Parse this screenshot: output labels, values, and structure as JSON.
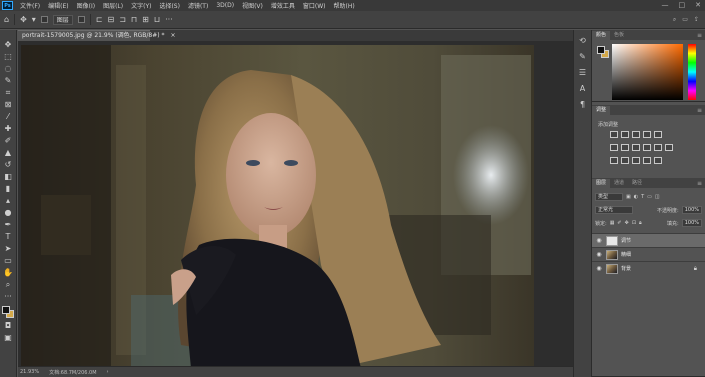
{
  "menubar": {
    "logo": "Ps",
    "items": [
      "文件(F)",
      "编辑(E)",
      "图像(I)",
      "图层(L)",
      "文字(Y)",
      "选择(S)",
      "滤镜(T)",
      "3D(D)",
      "视图(V)",
      "增效工具",
      "窗口(W)",
      "帮助(H)"
    ],
    "window_controls": [
      "—",
      "□",
      "✕"
    ]
  },
  "options_bar": {
    "layer_dropdown": "图层",
    "icons": [
      "home-icon",
      "move-icon",
      "auto-select-icon"
    ]
  },
  "document": {
    "tab_title": "portrait-1579005.jpg @ 21.9% (调色, RGB/8#) *",
    "close": "×"
  },
  "status": {
    "zoom": "21.93%",
    "doc_info": "文档:68.7M/206.0M"
  },
  "color_panel": {
    "tabs": [
      "颜色",
      "色板"
    ],
    "foreground": "#111111",
    "background": "#d4a94a"
  },
  "adjustments_panel": {
    "tabs": [
      "调整"
    ],
    "subtitle": "添加调整"
  },
  "layers_panel": {
    "tabs": [
      "图层",
      "通道",
      "路径"
    ],
    "filter_kind": "类型",
    "blend_mode": "正常光",
    "opacity_label": "不透明度:",
    "opacity_value": "100%",
    "lock_label": "锁定:",
    "fill_label": "填充:",
    "fill_value": "100%",
    "layers": [
      {
        "name": "调节",
        "selected": true
      },
      {
        "name": "精细",
        "selected": false
      },
      {
        "name": "背景",
        "selected": false,
        "locked": true
      }
    ]
  }
}
